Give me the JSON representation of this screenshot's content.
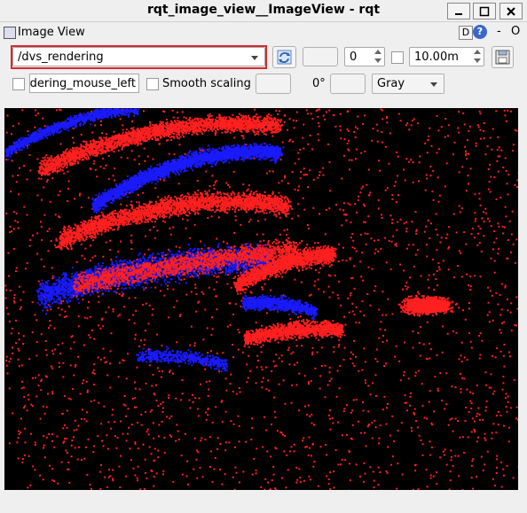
{
  "window": {
    "title": "rqt_image_view__ImageView - rqt",
    "minimize_icon": "minimize-icon",
    "maximize_icon": "maximize-icon",
    "close_icon": "close-icon"
  },
  "dock": {
    "title": "Image View",
    "d_label": "D",
    "help_label": "?",
    "dash_label": "-",
    "o_label": "O"
  },
  "toolbar": {
    "topic_value": "/dvs_rendering",
    "refresh_icon": "refresh-icon",
    "blank_field_1": "",
    "spin_value": "0",
    "max_range_value": "10.00m",
    "save_icon": "save-icon"
  },
  "toolbar2": {
    "mouse_topic_value": "endering_mouse_left",
    "smooth_scaling_label": "Smooth scaling",
    "rotation_label": "0°",
    "color_scheme_value": "Gray"
  },
  "colors": {
    "positive_events": "#ff2020",
    "negative_events": "#1a1aff",
    "background": "#000000",
    "highlight": "#d62b2b"
  }
}
